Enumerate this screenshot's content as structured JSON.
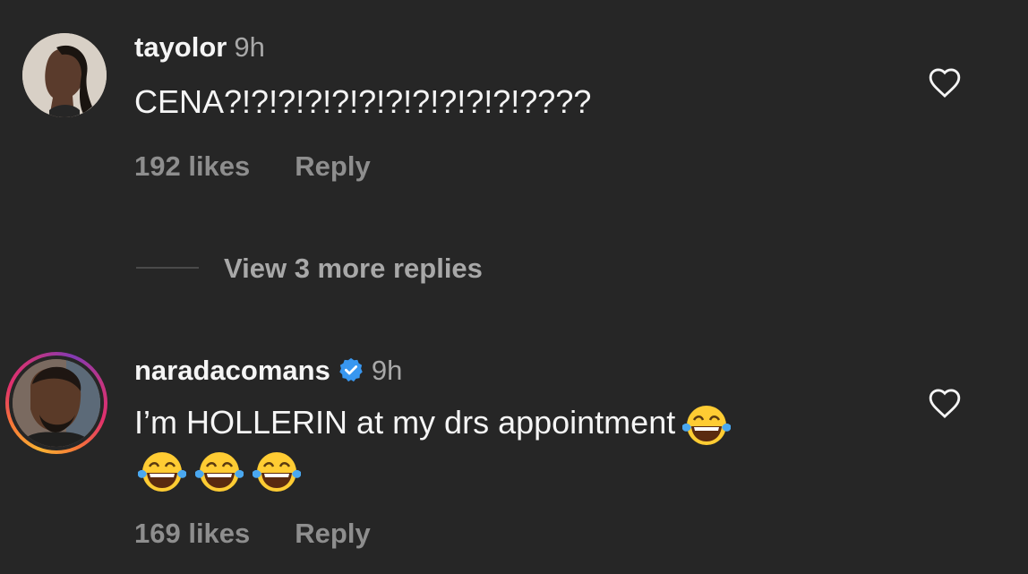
{
  "comments": [
    {
      "username": "tayolor",
      "time": "9h",
      "text": "CENA?!?!?!?!?!?!?!?!?!?!?!????",
      "likes": "192 likes",
      "reply_label": "Reply",
      "verified": false
    },
    {
      "username": "naradacomans",
      "time": "9h",
      "text": "I’m HOLLERIN at my drs appointment",
      "likes": "169 likes",
      "reply_label": "Reply",
      "verified": true,
      "emoji": "face-with-tears-of-joy",
      "emoji_count": 4
    }
  ],
  "view_replies": {
    "label": "View 3 more replies"
  },
  "colors": {
    "background": "#262626",
    "text": "#f5f5f5",
    "muted": "#8e8e8e",
    "verified": "#3897f0",
    "story_ring": [
      "#f9b233",
      "#e1306c",
      "#833ab4"
    ]
  },
  "icons": [
    "heart-outline-icon",
    "verified-badge-icon",
    "tears-of-joy-emoji"
  ]
}
